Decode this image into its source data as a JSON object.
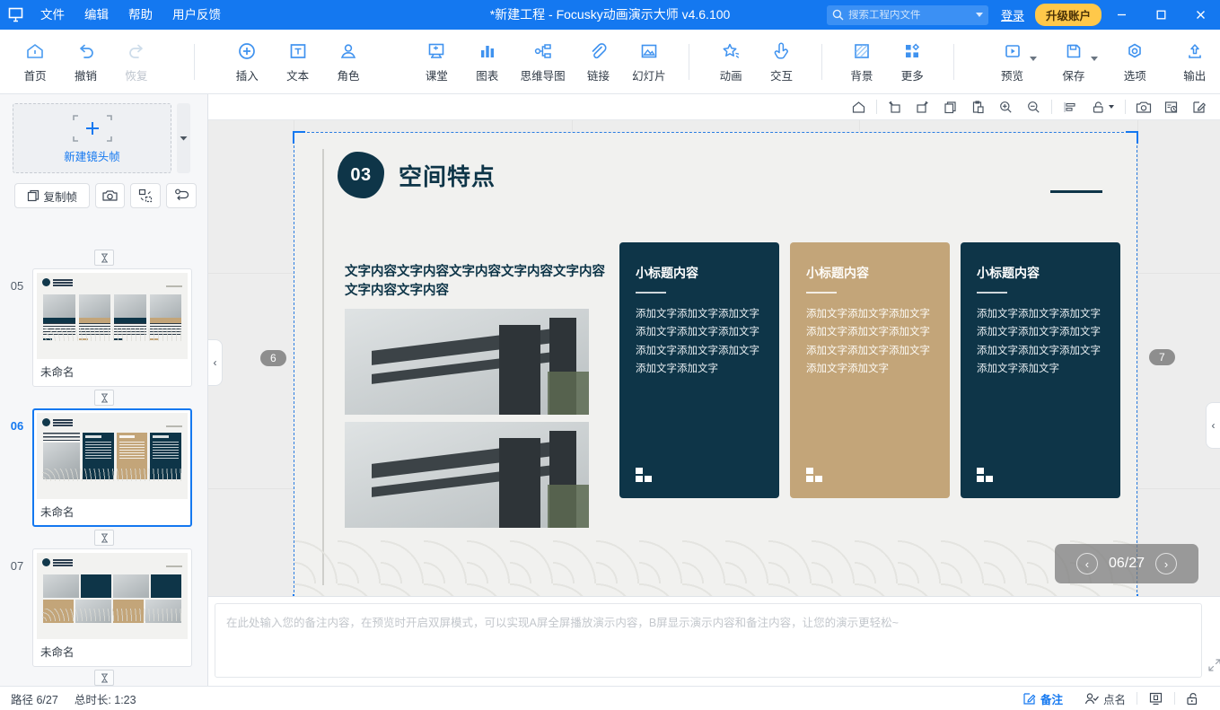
{
  "titlebar": {
    "app_icon": "focusky-logo-icon",
    "menus": [
      "文件",
      "编辑",
      "帮助",
      "用户反馈"
    ],
    "title": "*新建工程 - Focusky动画演示大师  v4.6.100",
    "search_placeholder": "搜索工程内文件",
    "search_value": "",
    "login_label": "登录",
    "upgrade_label": "升级账户",
    "window_buttons": [
      "minimize",
      "maximize",
      "close"
    ],
    "bg_color": "#1478f0",
    "accent_upgrade": "#ffc84a"
  },
  "ribbon": {
    "groups": [
      {
        "items": [
          {
            "label": "首页",
            "icon": "home-icon",
            "disabled": false,
            "dropdown": false
          },
          {
            "label": "撤销",
            "icon": "undo-icon",
            "disabled": false,
            "dropdown": false
          },
          {
            "label": "恢复",
            "icon": "redo-icon",
            "disabled": true,
            "dropdown": false
          }
        ]
      },
      {
        "items": [
          {
            "label": "插入",
            "icon": "plus-circle-icon",
            "disabled": false,
            "dropdown": false
          },
          {
            "label": "文本",
            "icon": "text-box-icon",
            "disabled": false,
            "dropdown": false
          },
          {
            "label": "角色",
            "icon": "character-icon",
            "disabled": false,
            "dropdown": false
          },
          {
            "label": "课堂",
            "icon": "classroom-icon",
            "disabled": false,
            "dropdown": false
          },
          {
            "label": "图表",
            "icon": "bar-chart-icon",
            "disabled": false,
            "dropdown": false
          },
          {
            "label": "思维导图",
            "icon": "mindmap-icon",
            "disabled": false,
            "dropdown": false
          },
          {
            "label": "链接",
            "icon": "link-paperclip-icon",
            "disabled": false,
            "dropdown": false
          },
          {
            "label": "幻灯片",
            "icon": "slide-image-icon",
            "disabled": false,
            "dropdown": false
          }
        ]
      },
      {
        "items": [
          {
            "label": "动画",
            "icon": "star-animation-icon",
            "disabled": false,
            "dropdown": false
          },
          {
            "label": "交互",
            "icon": "hand-click-icon",
            "disabled": false,
            "dropdown": false
          }
        ]
      },
      {
        "items": [
          {
            "label": "背景",
            "icon": "background-hatch-icon",
            "disabled": false,
            "dropdown": false
          },
          {
            "label": "更多",
            "icon": "more-grid-icon",
            "disabled": false,
            "dropdown": false
          }
        ]
      },
      {
        "items": [
          {
            "label": "预览",
            "icon": "preview-play-icon",
            "disabled": false,
            "dropdown": true
          },
          {
            "label": "保存",
            "icon": "save-disk-icon",
            "disabled": false,
            "dropdown": true
          },
          {
            "label": "选项",
            "icon": "options-gear-icon",
            "disabled": false,
            "dropdown": false
          },
          {
            "label": "输出",
            "icon": "export-upload-icon",
            "disabled": false,
            "dropdown": false
          }
        ]
      }
    ]
  },
  "left_panel": {
    "new_frame_label": "新建镜头帧",
    "new_frame_icon": "plus-crop-icon",
    "tools": [
      {
        "label": "复制帧",
        "icon": "duplicate-frame-icon",
        "kind": "wide"
      },
      {
        "label": "",
        "icon": "camera-icon",
        "kind": "square"
      },
      {
        "label": "",
        "icon": "fit-frame-icon",
        "kind": "square"
      },
      {
        "label": "",
        "icon": "path-route-icon",
        "kind": "square"
      }
    ],
    "slides": [
      {
        "number": "05",
        "name": "未命名",
        "selected": false,
        "layout": "four-column",
        "logo_text": "风格分类"
      },
      {
        "number": "06",
        "name": "未命名",
        "selected": true,
        "layout": "text-photo-cards",
        "logo_text": "空间特点"
      },
      {
        "number": "07",
        "name": "未命名",
        "selected": false,
        "layout": "grid-mixed",
        "logo_text": "案例赏析"
      }
    ]
  },
  "canvas_toolbar": {
    "buttons": [
      "home-icon",
      "rotate-left-icon",
      "rotate-right-icon",
      "copy-icon",
      "paste-icon",
      "zoom-in-icon",
      "zoom-out-icon",
      "align-icon",
      "lock-icon",
      "camera-icon",
      "timer-record-icon",
      "edit-pencil-icon"
    ]
  },
  "slide": {
    "badge_number": "03",
    "title": "空间特点",
    "body_text": "文字内容文字内容文字内容文字内容文字内容文字内容文字内容",
    "cards": [
      {
        "title": "小标题内容",
        "text": "添加文字添加文字添加文字添加文字添加文字添加文字添加文字添加文字添加文字添加文字添加文字",
        "color": "#0e3548"
      },
      {
        "title": "小标题内容",
        "text": "添加文字添加文字添加文字添加文字添加文字添加文字添加文字添加文字添加文字添加文字添加文字",
        "color": "#c3a579"
      },
      {
        "title": "小标题内容",
        "text": "添加文字添加文字添加文字添加文字添加文字添加文字添加文字添加文字添加文字添加文字添加文字",
        "color": "#0e3548"
      }
    ],
    "left_marker": "6",
    "right_marker": "7",
    "page_indicator": "06/27",
    "nav_prev": "‹",
    "nav_next": "›"
  },
  "notes": {
    "placeholder": "在此处输入您的备注内容，在预览时开启双屏模式，可以实现A屏全屏播放演示内容，B屏显示演示内容和备注内容，让您的演示更轻松~",
    "value": "",
    "expand_icon": "expand-arrows-icon"
  },
  "statusbar": {
    "path_label": "路径 6/27",
    "duration_label": "总时长: 1:23",
    "right_buttons": [
      {
        "label": "备注",
        "icon": "notes-edit-icon",
        "active": true
      },
      {
        "label": "点名",
        "icon": "roll-call-icon",
        "active": false
      },
      {
        "label": "",
        "icon": "presenter-screen-icon",
        "active": false
      },
      {
        "label": "",
        "icon": "lock-open-icon",
        "active": false
      }
    ]
  },
  "collapse": {
    "left_icon": "‹",
    "right_icon": "‹"
  }
}
